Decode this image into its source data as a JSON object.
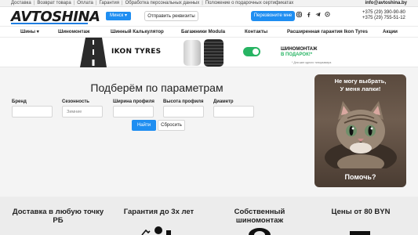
{
  "topbar": {
    "links": [
      "Доставка",
      "Возврат товара",
      "Оплата",
      "Гарантия",
      "Обработка персональных данных",
      "Положение о подарочных сертификатах"
    ],
    "email": "info@avtoshina.by"
  },
  "header": {
    "logo": "AVTOSHINA",
    "city": "Минск ▾",
    "requisites": "Отправить реквизиты",
    "callback": "Перезвоните мне",
    "phones": [
      "+375 (29) 390-90-80",
      "+375 (29) 755-51-12"
    ],
    "social_icons": [
      "instagram-icon",
      "facebook-icon",
      "telegram-icon",
      "viber-icon"
    ]
  },
  "nav": {
    "items": [
      "Шины ▾",
      "Шиномонтаж",
      "Шинный Калькулятор",
      "Багажники Modula",
      "Контакты",
      "Расширенная гарантия Ikon Tyres",
      "Акции"
    ]
  },
  "banner": {
    "brand": "IKON TYRES",
    "promo_line1": "ШИНОМОНТАЖ",
    "promo_line2": "В ПОДАРОК!*",
    "footnote": "* Для шин одного типоразмера"
  },
  "selection": {
    "title": "Подберём по параметрам",
    "fields": [
      {
        "label": "Бренд",
        "placeholder": ""
      },
      {
        "label": "Сезонность",
        "placeholder": "Зимние"
      },
      {
        "label": "Ширина профиля",
        "placeholder": ""
      },
      {
        "label": "Высота профиля",
        "placeholder": ""
      },
      {
        "label": "Диаметр",
        "placeholder": ""
      }
    ],
    "find": "Найти",
    "reset": "Сбросить"
  },
  "help_card": {
    "title_line1": "Не могу выбрать,",
    "title_line2": "У меня лапки!",
    "button": "Помочь?"
  },
  "features": [
    {
      "line1": "Доставка в любую точку",
      "line2": "РБ"
    },
    {
      "line1": "Гарантия до 3х лет",
      "line2": ""
    },
    {
      "line1": "Собственный",
      "line2": "шиномонтаж"
    },
    {
      "line1": "Цены от 80 BYN",
      "line2": ""
    }
  ],
  "colors": {
    "accent": "#1f8ef1",
    "green": "#27b463"
  }
}
